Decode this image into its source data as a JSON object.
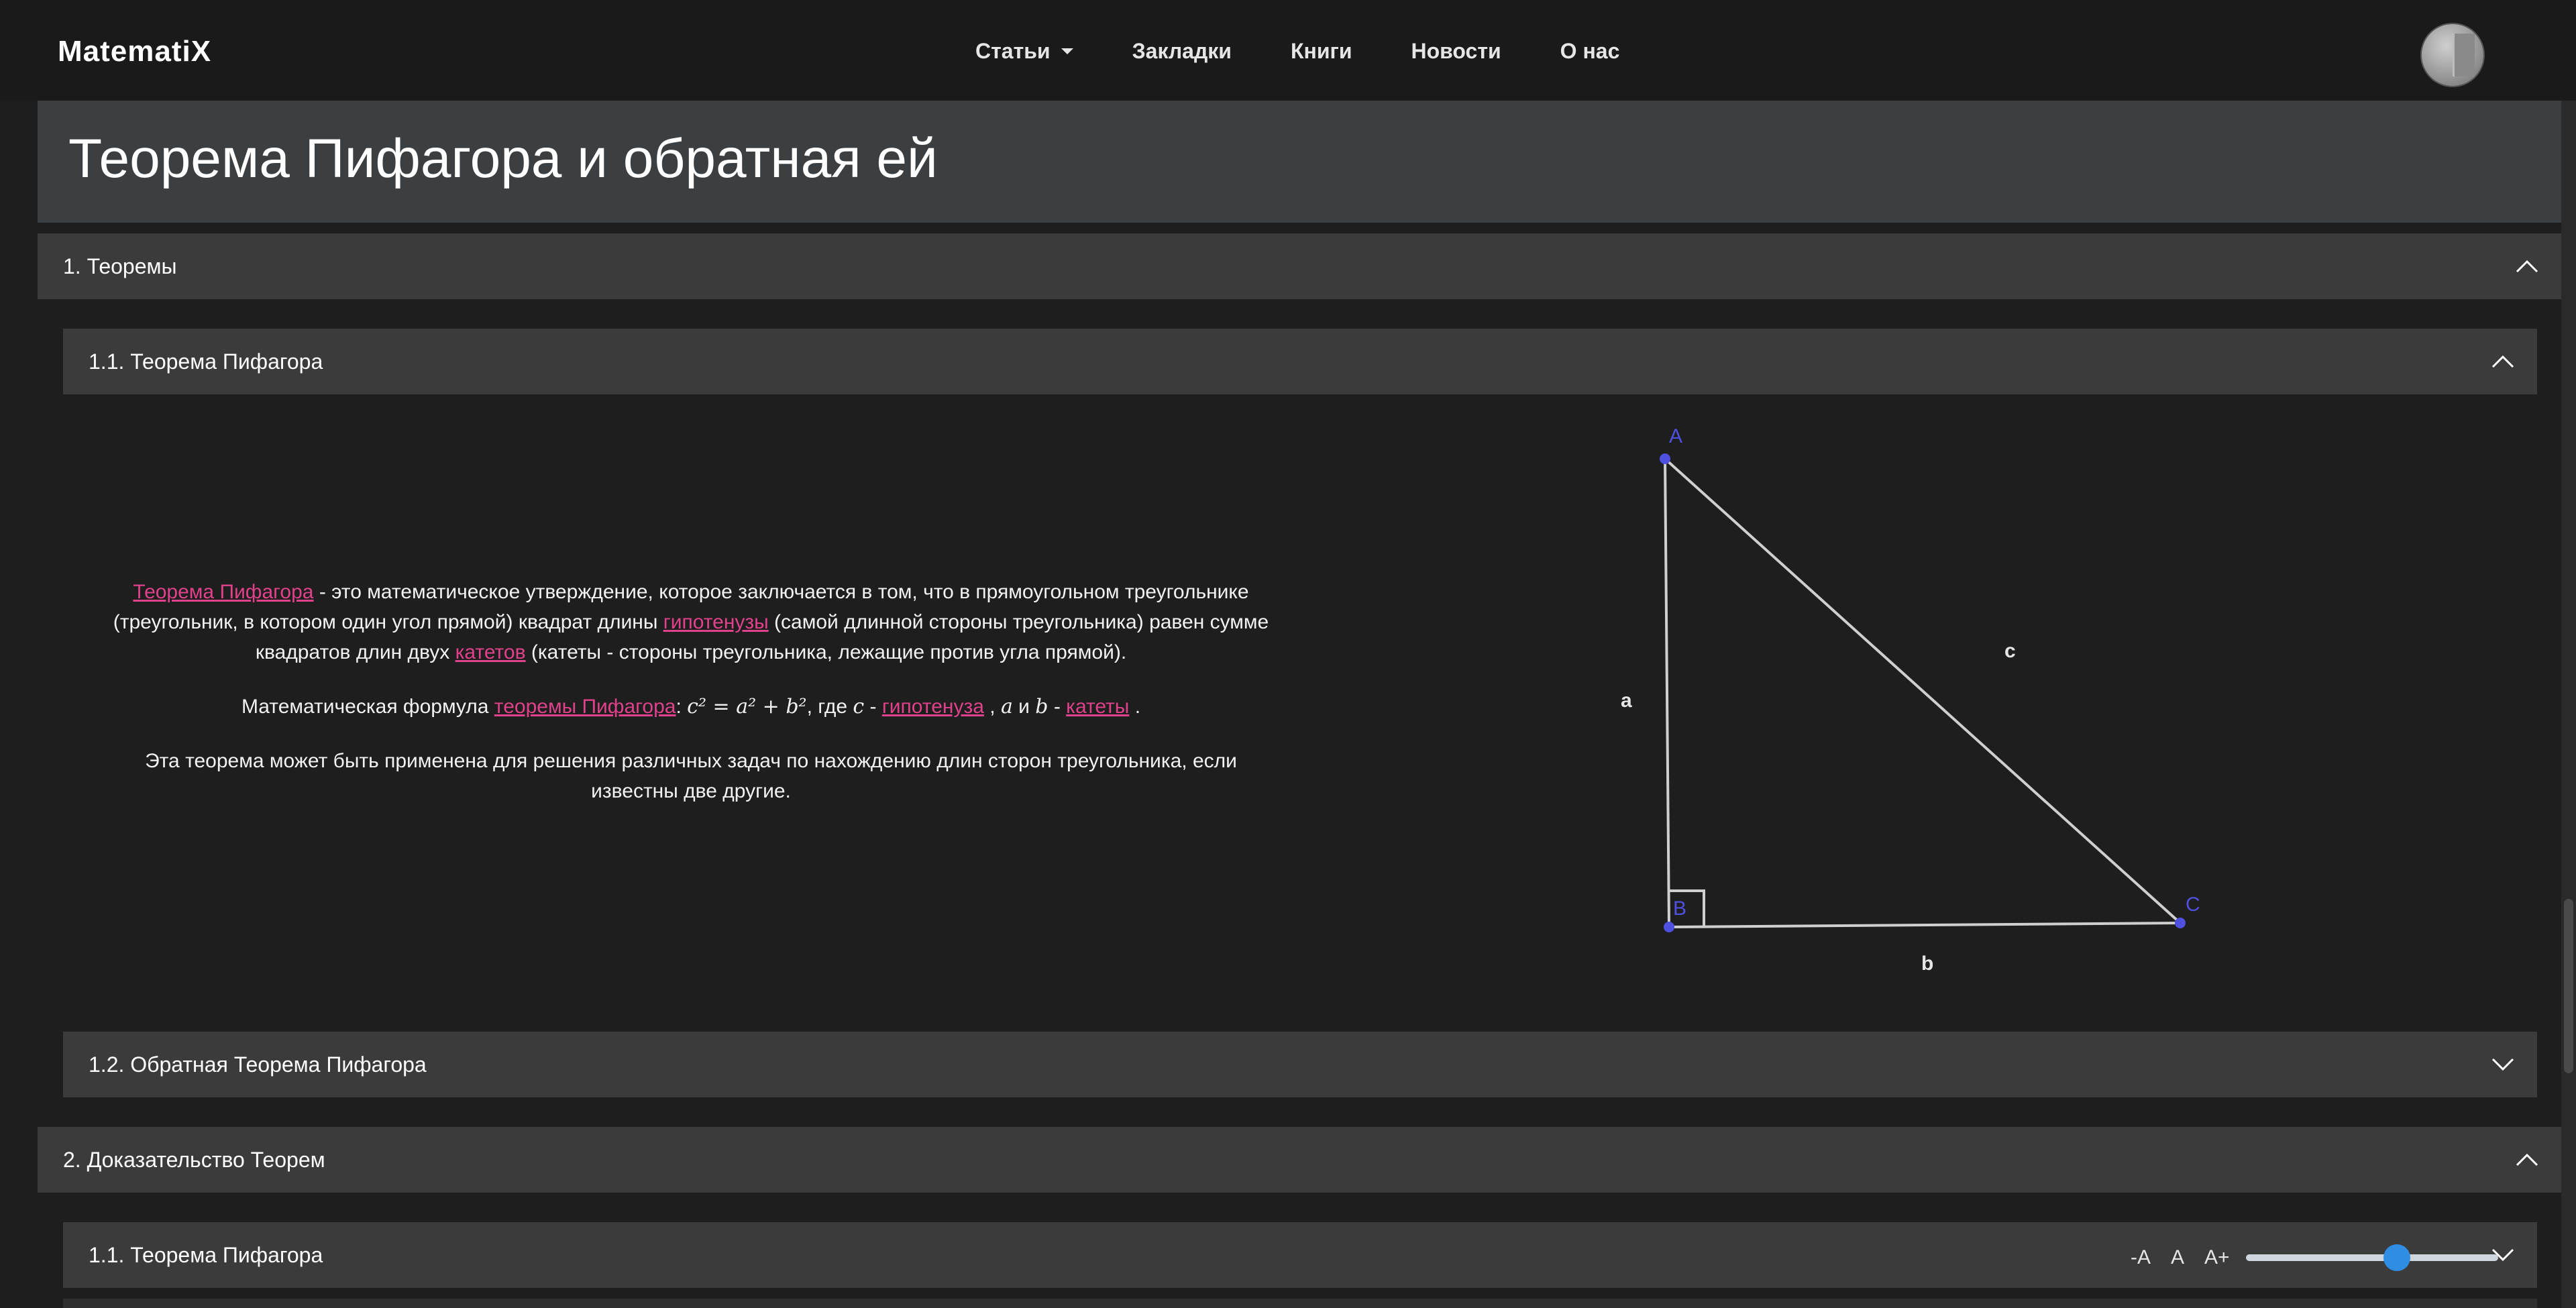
{
  "brand": "MatematiX",
  "nav": {
    "items": [
      {
        "label": "Статьи",
        "dropdown": true
      },
      {
        "label": "Закладки"
      },
      {
        "label": "Книги"
      },
      {
        "label": "Новости"
      },
      {
        "label": "О нас"
      }
    ]
  },
  "page_title": "Теорема Пифагора и обратная ей",
  "sections": {
    "s1": {
      "label": "1. Теоремы",
      "expanded": true
    },
    "s1_1": {
      "label": "1.1. Теорема Пифагора",
      "expanded": true
    },
    "s1_2": {
      "label": "1.2. Обратная Теорема Пифагора",
      "expanded": false
    },
    "s2": {
      "label": "2. Доказательство Теорем",
      "expanded": true
    },
    "s2_1": {
      "label": "1.1. Теорема Пифагора",
      "expanded": false
    }
  },
  "content": {
    "p1": {
      "link1": "Теорема Пифагора",
      "t1": " - это математическое утверждение, которое заключается в том, что в прямоугольном треугольнике (треугольник, в котором один угол прямой) квадрат длины ",
      "link2": "гипотенузы",
      "t2": " (самой длинной стороны треугольника) равен сумме квадратов длин двух ",
      "link3": "катетов",
      "t3": " (катеты - стороны треугольника, лежащие против угла прямой)."
    },
    "p2": {
      "t1": "Математическая формула ",
      "link1": "теоремы Пифагора",
      "formula": "c² = a² + b²",
      "t2": ", где ",
      "var_c": "c",
      "t3": " - ",
      "link2": "гипотенуза",
      "t4": " , ",
      "var_a": "a",
      "t5": " и ",
      "var_b": "b",
      "t6": " - ",
      "link3": "катеты",
      "t7": " ."
    },
    "p3": "Эта теорема может быть применена для решения различных задач по нахождению длин сторон треугольника, если известны две другие."
  },
  "figure": {
    "vertex_labels": {
      "A": "A",
      "B": "B",
      "C": "C"
    },
    "side_labels": {
      "a": "a",
      "b": "b",
      "c": "c"
    },
    "point_color": "#5050e0",
    "line_color": "#cfcfcf"
  },
  "font_controls": {
    "decrease": "-A",
    "reset": "A",
    "increase": "A+",
    "slider_value": 0.6
  },
  "colors": {
    "link": "#e0418b",
    "header_bg": "#3b3b3b",
    "title_bg": "#3c3f42",
    "slider_knob": "#2f8de4"
  }
}
